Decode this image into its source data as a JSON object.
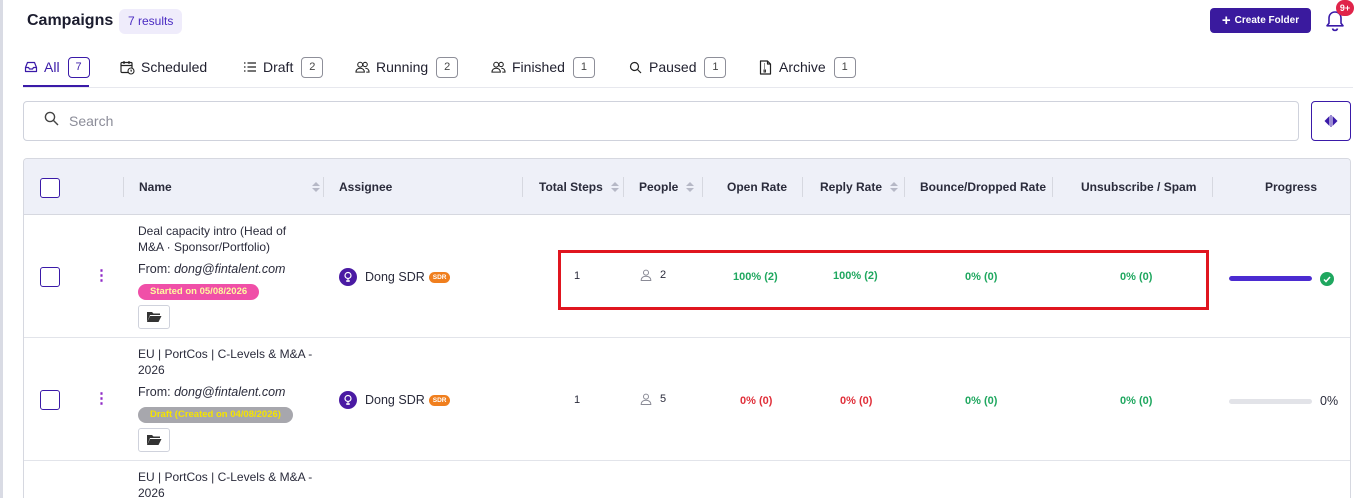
{
  "header": {
    "title": "Campaigns",
    "results": "7 results",
    "create_folder_label": "Create Folder",
    "notification_count": "9+"
  },
  "tabs": [
    {
      "label": "All",
      "count": "7",
      "icon": "inbox-icon",
      "active": true
    },
    {
      "label": "Scheduled",
      "icon": "calendar-clock-icon"
    },
    {
      "label": "Draft",
      "count": "2",
      "icon": "list-icon"
    },
    {
      "label": "Running",
      "count": "2",
      "icon": "users-icon"
    },
    {
      "label": "Finished",
      "count": "1",
      "icon": "users-icon"
    },
    {
      "label": "Paused",
      "count": "1",
      "icon": "search-icon"
    },
    {
      "label": "Archive",
      "count": "1",
      "icon": "archive-file-icon"
    }
  ],
  "search": {
    "placeholder": "Search"
  },
  "table": {
    "columns": [
      "Name",
      "Assignee",
      "Total Steps",
      "People",
      "Open Rate",
      "Reply Rate",
      "Bounce/Dropped Rate",
      "Unsubscribe / Spam",
      "Progress"
    ],
    "rows": [
      {
        "name_line1": "Deal capacity intro (Head of",
        "name_line2": "M&A · Sponsor/Portfolio)",
        "from_prefix": "From: ",
        "from_email": "dong@fintalent.com",
        "status": "Started on 05/08/2026",
        "assignee": "Dong SDR",
        "assignee_badge": "SDR",
        "total_steps": "1",
        "people": "2",
        "open_rate": "100% (2)",
        "reply_rate": "100% (2)",
        "bounce_rate": "0% (0)",
        "unsub_rate": "0% (0)",
        "progress": 1.0,
        "progress_label": ""
      },
      {
        "name_line1": "EU | PortCos | C-Levels & M&A -",
        "name_line2": "2026",
        "from_prefix": "From: ",
        "from_email": "dong@fintalent.com",
        "status": "Draft (Created on 04/08/2026)",
        "assignee": "Dong SDR",
        "assignee_badge": "SDR",
        "total_steps": "1",
        "people": "5",
        "open_rate": "0% (0)",
        "reply_rate": "0% (0)",
        "bounce_rate": "0% (0)",
        "unsub_rate": "0% (0)",
        "progress": 0.0,
        "progress_label": "0%"
      },
      {
        "name_line1": "EU | PortCos | C-Levels & M&A -",
        "name_line2": "2026"
      }
    ]
  },
  "colors": {
    "accent": "#3a1aa8",
    "started_pill": "#f04fa8",
    "draft_pill": "#a7a7ad",
    "draft_text": "#f5e400",
    "green": "#1fa75f",
    "red": "#e0303a",
    "highlight": "#e0151f"
  }
}
